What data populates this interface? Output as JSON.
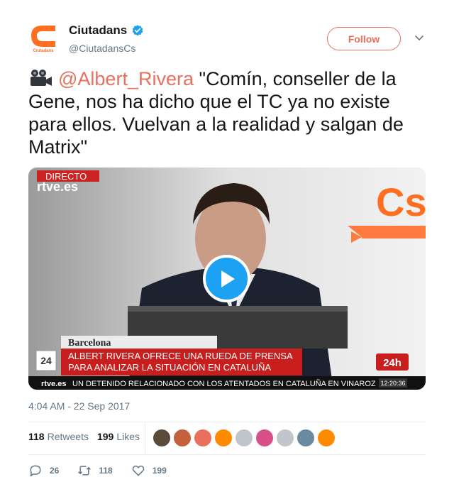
{
  "account": {
    "display_name": "Ciutadans",
    "handle": "@CiutadansCs",
    "avatar_text": "Cs",
    "avatar_subtext": "Ciutadans",
    "verified": true
  },
  "follow_label": "Follow",
  "tweet": {
    "emoji_icon": "video-camera-icon",
    "mention": "@Albert_Rivera",
    "text": " \"Comín, conseller de la Gene, nos ha dicho que el TC ya no existe para ellos. Vuelvan a la realidad y salgan de Matrix\""
  },
  "video": {
    "live_badge": "DIRECTO",
    "channel_logo": "rtve.es",
    "brand_logo": "Cs",
    "location": "Barcelona",
    "headline_line1": "ALBERT RIVERA OFRECE UNA RUEDA DE PRENSA",
    "headline_line2": "PARA ANALIZAR LA SITUACIÓN EN CATALUÑA",
    "date_box_number": "24",
    "channel_badge": "24h",
    "ticker_logo": "rtve.es",
    "ticker_text": "UN DETENIDO RELACIONADO CON LOS ATENTADOS EN CATALUÑA EN VINAROZ",
    "ticker_time": "12:20:36",
    "play_icon": "play-icon"
  },
  "timestamp": "4:04 AM - 22 Sep 2017",
  "stats": {
    "retweets_count": "118",
    "retweets_label": "Retweets",
    "likes_count": "199",
    "likes_label": "Likes"
  },
  "likers": [
    {
      "name": "liker-avatar-1",
      "color": "#5a4a3a"
    },
    {
      "name": "liker-avatar-2",
      "color": "#c4603c"
    },
    {
      "name": "liker-avatar-3",
      "color": "#e9705c"
    },
    {
      "name": "liker-avatar-4",
      "color": "#ff8a00"
    },
    {
      "name": "liker-avatar-5",
      "color": "#c0c6cb"
    },
    {
      "name": "liker-avatar-6",
      "color": "#d94f8a"
    },
    {
      "name": "liker-avatar-7",
      "color": "#c0c6cb"
    },
    {
      "name": "liker-avatar-8",
      "color": "#6a8aa0"
    },
    {
      "name": "liker-avatar-9",
      "color": "#ff8a00"
    }
  ],
  "actions": {
    "reply_count": "26",
    "retweet_count": "118",
    "like_count": "199"
  },
  "colors": {
    "brand": "#e9705c",
    "verified": "#1da1f2",
    "text_secondary": "#657786"
  }
}
